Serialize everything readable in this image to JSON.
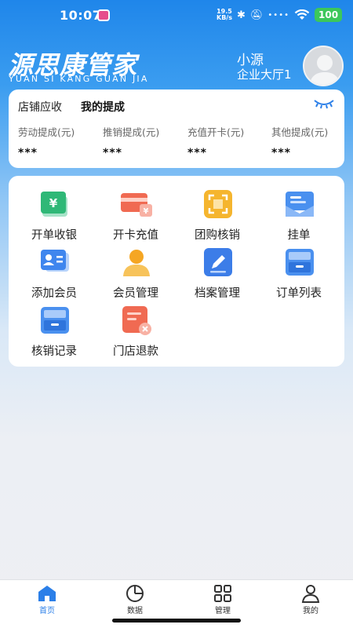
{
  "status_bar": {
    "time": "10:07",
    "net_speed_top": "19.5",
    "net_speed_unit": "KB/s",
    "battery": "100"
  },
  "header": {
    "brand_title": "源思康管家",
    "brand_subtitle": "YUAN SI KANG GUAN JIA",
    "user_name": "小源",
    "user_hall": "企业大厅1"
  },
  "commission": {
    "tab_store": "店铺应收",
    "tab_mine": "我的提成",
    "metrics": [
      {
        "label": "劳动提成(元)",
        "value": "***"
      },
      {
        "label": "推销提成(元)",
        "value": "***"
      },
      {
        "label": "充值开卡(元)",
        "value": "***"
      },
      {
        "label": "其他提成(元)",
        "value": "***"
      }
    ]
  },
  "grid": {
    "items": [
      {
        "label": "开单收银",
        "icon": "cashier-icon"
      },
      {
        "label": "开卡充值",
        "icon": "card-recharge-icon"
      },
      {
        "label": "团购核销",
        "icon": "group-buy-verify-icon"
      },
      {
        "label": "挂单",
        "icon": "pending-order-icon"
      },
      {
        "label": "添加会员",
        "icon": "add-member-icon"
      },
      {
        "label": "会员管理",
        "icon": "member-manage-icon"
      },
      {
        "label": "档案管理",
        "icon": "archive-manage-icon"
      },
      {
        "label": "订单列表",
        "icon": "order-list-icon"
      },
      {
        "label": "核销记录",
        "icon": "verify-record-icon"
      },
      {
        "label": "门店退款",
        "icon": "store-refund-icon"
      }
    ]
  },
  "bottom_nav": {
    "items": [
      {
        "label": "首页",
        "icon": "home-icon",
        "active": true
      },
      {
        "label": "数据",
        "icon": "pie-chart-icon",
        "active": false
      },
      {
        "label": "管理",
        "icon": "grid-icon",
        "active": false
      },
      {
        "label": "我的",
        "icon": "user-icon",
        "active": false
      }
    ]
  },
  "colors": {
    "brand_blue": "#1f86ea",
    "active_tab": "#2b7fe8",
    "battery_green": "#3cc75a"
  }
}
